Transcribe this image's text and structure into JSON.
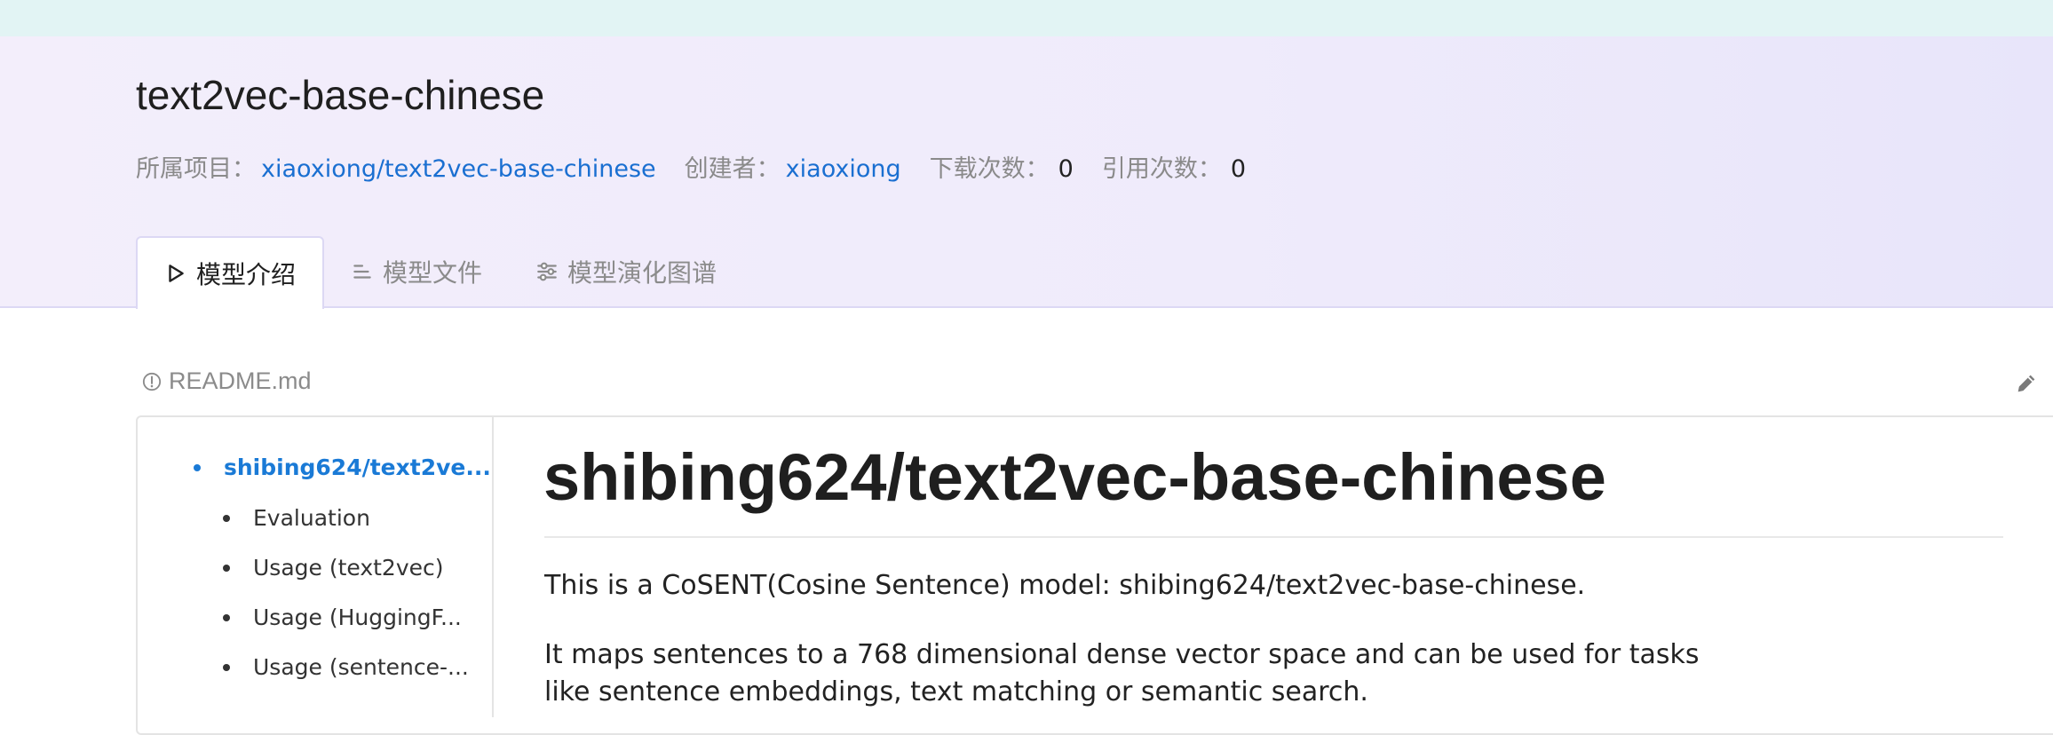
{
  "model": {
    "title": "text2vec-base-chinese",
    "project_label": "所属项目：",
    "project_link": "xiaoxiong/text2vec-base-chinese",
    "creator_label": "创建者：",
    "creator_link": "xiaoxiong",
    "downloads_label": "下载次数：",
    "downloads_value": "0",
    "citations_label": "引用次数：",
    "citations_value": "0"
  },
  "tabs": [
    {
      "label": "模型介绍",
      "icon": "play-outline-icon",
      "active": true
    },
    {
      "label": "模型文件",
      "icon": "list-icon",
      "active": false
    },
    {
      "label": "模型演化图谱",
      "icon": "sliders-icon",
      "active": false
    }
  ],
  "readme": {
    "filename": "README.md",
    "icon": "info-circle-icon",
    "edit_icon": "pencil-icon"
  },
  "toc": [
    {
      "label": "shibing624/text2ve...",
      "active": true
    },
    {
      "label": "Evaluation",
      "active": false
    },
    {
      "label": "Usage (text2vec)",
      "active": false
    },
    {
      "label": "Usage (HuggingF...",
      "active": false
    },
    {
      "label": "Usage (sentence-...",
      "active": false
    }
  ],
  "document": {
    "heading": "shibing624/text2vec-base-chinese",
    "paragraph1": "This is a CoSENT(Cosine Sentence) model: shibing624/text2vec-base-chinese.",
    "paragraph2_line1": "It maps sentences to a 768 dimensional dense vector space and can be used for tasks",
    "paragraph2_line2": "like sentence embeddings, text matching or semantic search."
  },
  "colors": {
    "link": "#1a6fd1",
    "toc_active": "#1a7ad6",
    "hero_bg": "#f3eefb",
    "top_strip": "#e2f4f4"
  }
}
